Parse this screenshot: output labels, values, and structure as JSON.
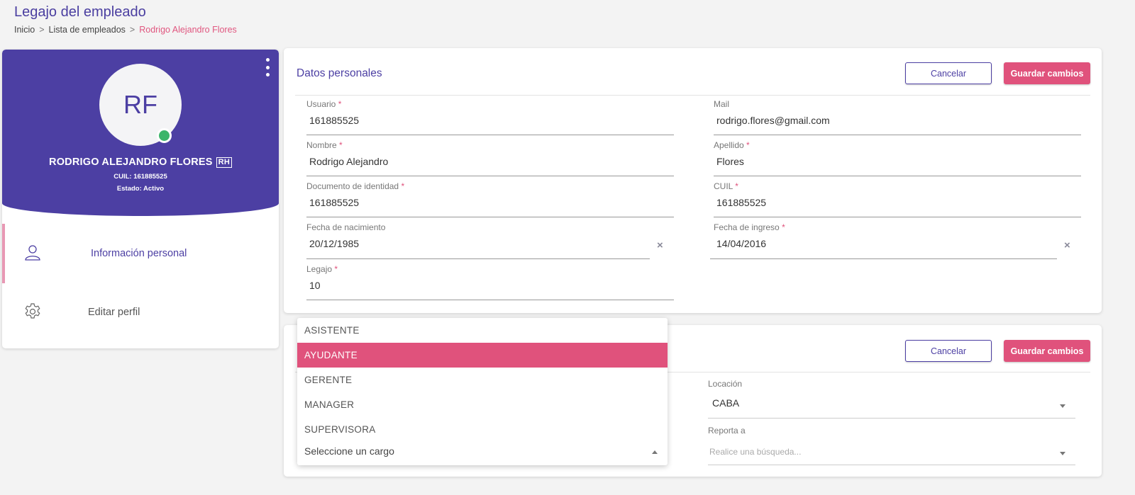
{
  "page": {
    "title": "Legajo del empleado",
    "breadcrumb": [
      "Inicio",
      "Lista de empleados",
      "Rodrigo Alejandro Flores"
    ],
    "breadcrumb_sep": ">"
  },
  "profile": {
    "initials": "RF",
    "name": "RODRIGO ALEJANDRO FLORES",
    "badge": "RH",
    "cuil": "CUIL: 161885525",
    "estado": "Estado: Activo",
    "status_color": "#3cb56a",
    "menu": [
      {
        "label": "Información personal",
        "icon": "user-icon",
        "active": true
      },
      {
        "label": "Editar perfil",
        "icon": "gear-icon",
        "active": false
      }
    ]
  },
  "personal": {
    "title": "Datos personales",
    "cancel_label": "Cancelar",
    "save_label": "Guardar cambios",
    "required_mark": "*",
    "fields": {
      "usuario": {
        "label": "Usuario",
        "value": "161885525"
      },
      "mail": {
        "label": "Mail",
        "value": "rodrigo.flores@gmail.com"
      },
      "nombre": {
        "label": "Nombre",
        "value": "Rodrigo Alejandro"
      },
      "apellido": {
        "label": "Apellido",
        "value": "Flores"
      },
      "documento": {
        "label": "Documento de identidad",
        "value": "161885525"
      },
      "cuil": {
        "label": "CUIL",
        "value": "161885525"
      },
      "nacimiento": {
        "label": "Fecha de nacimiento",
        "value": "20/12/1985"
      },
      "ingreso": {
        "label": "Fecha de ingreso",
        "value": "14/04/2016"
      },
      "legajo": {
        "label": "Legajo",
        "value": "10"
      }
    },
    "clear_glyph": "×"
  },
  "work": {
    "cancel_label": "Cancelar",
    "save_label": "Guardar cambios",
    "locacion": {
      "label": "Locación",
      "value": "CABA"
    },
    "reporta": {
      "label": "Reporta a",
      "placeholder": "Realice una búsqueda..."
    },
    "cargo": {
      "placeholder": "Seleccione un cargo",
      "options": [
        "ASISTENTE",
        "AYUDANTE",
        "GERENTE",
        "MANAGER",
        "SUPERVISORA"
      ],
      "highlighted": "AYUDANTE"
    }
  },
  "colors": {
    "primary": "#4c3fa3",
    "accent": "#e0527c"
  }
}
